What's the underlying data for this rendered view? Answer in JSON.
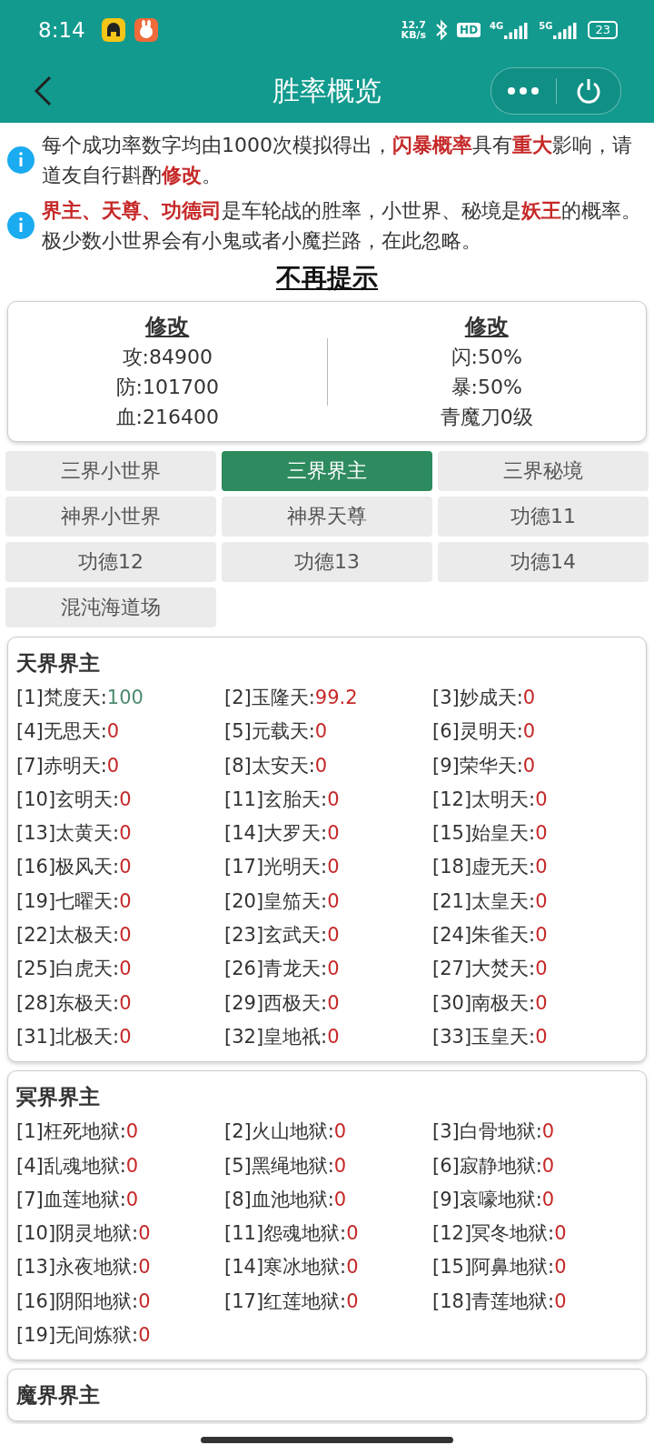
{
  "status_bar": {
    "time": "8:14",
    "speed_value": "12.7",
    "speed_unit": "KB/s",
    "hd": "HD",
    "net1": "4G",
    "net2": "5G",
    "battery": "23"
  },
  "header": {
    "title": "胜率概览"
  },
  "notices": [
    "每个成功率数字均由1000次模拟得出，**闪暴概率**具有**重大**影响，请道友自行斟酌**修改**。",
    "**界主、天尊、功德司**是车轮战的胜率，小世界、秘境是**妖王**的概率。极少数小世界会有小鬼或者小魔拦路，在此忽略。"
  ],
  "dismiss_link": "不再提示",
  "stats": [
    {
      "heading": "修改",
      "lines": [
        "攻:84900",
        "防:101700",
        "血:216400"
      ]
    },
    {
      "heading": "修改",
      "lines": [
        "闪:50%",
        "暴:50%",
        "青魔刀0级"
      ]
    }
  ],
  "tabs": [
    {
      "label": "三界小世界",
      "selected": false
    },
    {
      "label": "三界界主",
      "selected": true
    },
    {
      "label": "三界秘境",
      "selected": false
    },
    {
      "label": "神界小世界",
      "selected": false
    },
    {
      "label": "神界天尊",
      "selected": false
    },
    {
      "label": "功德11",
      "selected": false
    },
    {
      "label": "功德12",
      "selected": false
    },
    {
      "label": "功德13",
      "selected": false
    },
    {
      "label": "功德14",
      "selected": false
    },
    {
      "label": "混沌海道场",
      "selected": false
    }
  ],
  "sections": [
    {
      "title": "天界界主",
      "entries": [
        {
          "label": "[1]梵度天:",
          "value": "100",
          "color": "#4e8a70"
        },
        {
          "label": "[2]玉隆天:",
          "value": "99.2",
          "color": "#c62828"
        },
        {
          "label": "[3]妙成天:",
          "value": "0",
          "color": "#c62828"
        },
        {
          "label": "[4]无思天:",
          "value": "0",
          "color": "#c62828"
        },
        {
          "label": "[5]元载天:",
          "value": "0",
          "color": "#c62828"
        },
        {
          "label": "[6]灵明天:",
          "value": "0",
          "color": "#c62828"
        },
        {
          "label": "[7]赤明天:",
          "value": "0",
          "color": "#c62828"
        },
        {
          "label": "[8]太安天:",
          "value": "0",
          "color": "#c62828"
        },
        {
          "label": "[9]荣华天:",
          "value": "0",
          "color": "#c62828"
        },
        {
          "label": "[10]玄明天:",
          "value": "0",
          "color": "#c62828"
        },
        {
          "label": "[11]玄胎天:",
          "value": "0",
          "color": "#c62828"
        },
        {
          "label": "[12]太明天:",
          "value": "0",
          "color": "#c62828"
        },
        {
          "label": "[13]太黄天:",
          "value": "0",
          "color": "#c62828"
        },
        {
          "label": "[14]大罗天:",
          "value": "0",
          "color": "#c62828"
        },
        {
          "label": "[15]始皇天:",
          "value": "0",
          "color": "#c62828"
        },
        {
          "label": "[16]极风天:",
          "value": "0",
          "color": "#c62828"
        },
        {
          "label": "[17]光明天:",
          "value": "0",
          "color": "#c62828"
        },
        {
          "label": "[18]虚无天:",
          "value": "0",
          "color": "#c62828"
        },
        {
          "label": "[19]七曜天:",
          "value": "0",
          "color": "#c62828"
        },
        {
          "label": "[20]皇笳天:",
          "value": "0",
          "color": "#c62828"
        },
        {
          "label": "[21]太皇天:",
          "value": "0",
          "color": "#c62828"
        },
        {
          "label": "[22]太极天:",
          "value": "0",
          "color": "#c62828"
        },
        {
          "label": "[23]玄武天:",
          "value": "0",
          "color": "#c62828"
        },
        {
          "label": "[24]朱雀天:",
          "value": "0",
          "color": "#c62828"
        },
        {
          "label": "[25]白虎天:",
          "value": "0",
          "color": "#c62828"
        },
        {
          "label": "[26]青龙天:",
          "value": "0",
          "color": "#c62828"
        },
        {
          "label": "[27]大焚天:",
          "value": "0",
          "color": "#c62828"
        },
        {
          "label": "[28]东极天:",
          "value": "0",
          "color": "#c62828"
        },
        {
          "label": "[29]西极天:",
          "value": "0",
          "color": "#c62828"
        },
        {
          "label": "[30]南极天:",
          "value": "0",
          "color": "#c62828"
        },
        {
          "label": "[31]北极天:",
          "value": "0",
          "color": "#c62828"
        },
        {
          "label": "[32]皇地祇:",
          "value": "0",
          "color": "#c62828"
        },
        {
          "label": "[33]玉皇天:",
          "value": "0",
          "color": "#c62828"
        }
      ]
    },
    {
      "title": "冥界界主",
      "entries": [
        {
          "label": "[1]枉死地狱:",
          "value": "0",
          "color": "#c62828"
        },
        {
          "label": "[2]火山地狱:",
          "value": "0",
          "color": "#c62828"
        },
        {
          "label": "[3]白骨地狱:",
          "value": "0",
          "color": "#c62828"
        },
        {
          "label": "[4]乱魂地狱:",
          "value": "0",
          "color": "#c62828"
        },
        {
          "label": "[5]黑绳地狱:",
          "value": "0",
          "color": "#c62828"
        },
        {
          "label": "[6]寂静地狱:",
          "value": "0",
          "color": "#c62828"
        },
        {
          "label": "[7]血莲地狱:",
          "value": "0",
          "color": "#c62828"
        },
        {
          "label": "[8]血池地狱:",
          "value": "0",
          "color": "#c62828"
        },
        {
          "label": "[9]哀嚎地狱:",
          "value": "0",
          "color": "#c62828"
        },
        {
          "label": "[10]阴灵地狱:",
          "value": "0",
          "color": "#c62828"
        },
        {
          "label": "[11]怨魂地狱:",
          "value": "0",
          "color": "#c62828"
        },
        {
          "label": "[12]冥冬地狱:",
          "value": "0",
          "color": "#c62828"
        },
        {
          "label": "[13]永夜地狱:",
          "value": "0",
          "color": "#c62828"
        },
        {
          "label": "[14]寒冰地狱:",
          "value": "0",
          "color": "#c62828"
        },
        {
          "label": "[15]阿鼻地狱:",
          "value": "0",
          "color": "#c62828"
        },
        {
          "label": "[16]阴阳地狱:",
          "value": "0",
          "color": "#c62828"
        },
        {
          "label": "[17]红莲地狱:",
          "value": "0",
          "color": "#c62828"
        },
        {
          "label": "[18]青莲地狱:",
          "value": "0",
          "color": "#c62828"
        },
        {
          "label": "[19]无间炼狱:",
          "value": "0",
          "color": "#c62828"
        }
      ]
    },
    {
      "title": "魔界界主"
    }
  ]
}
